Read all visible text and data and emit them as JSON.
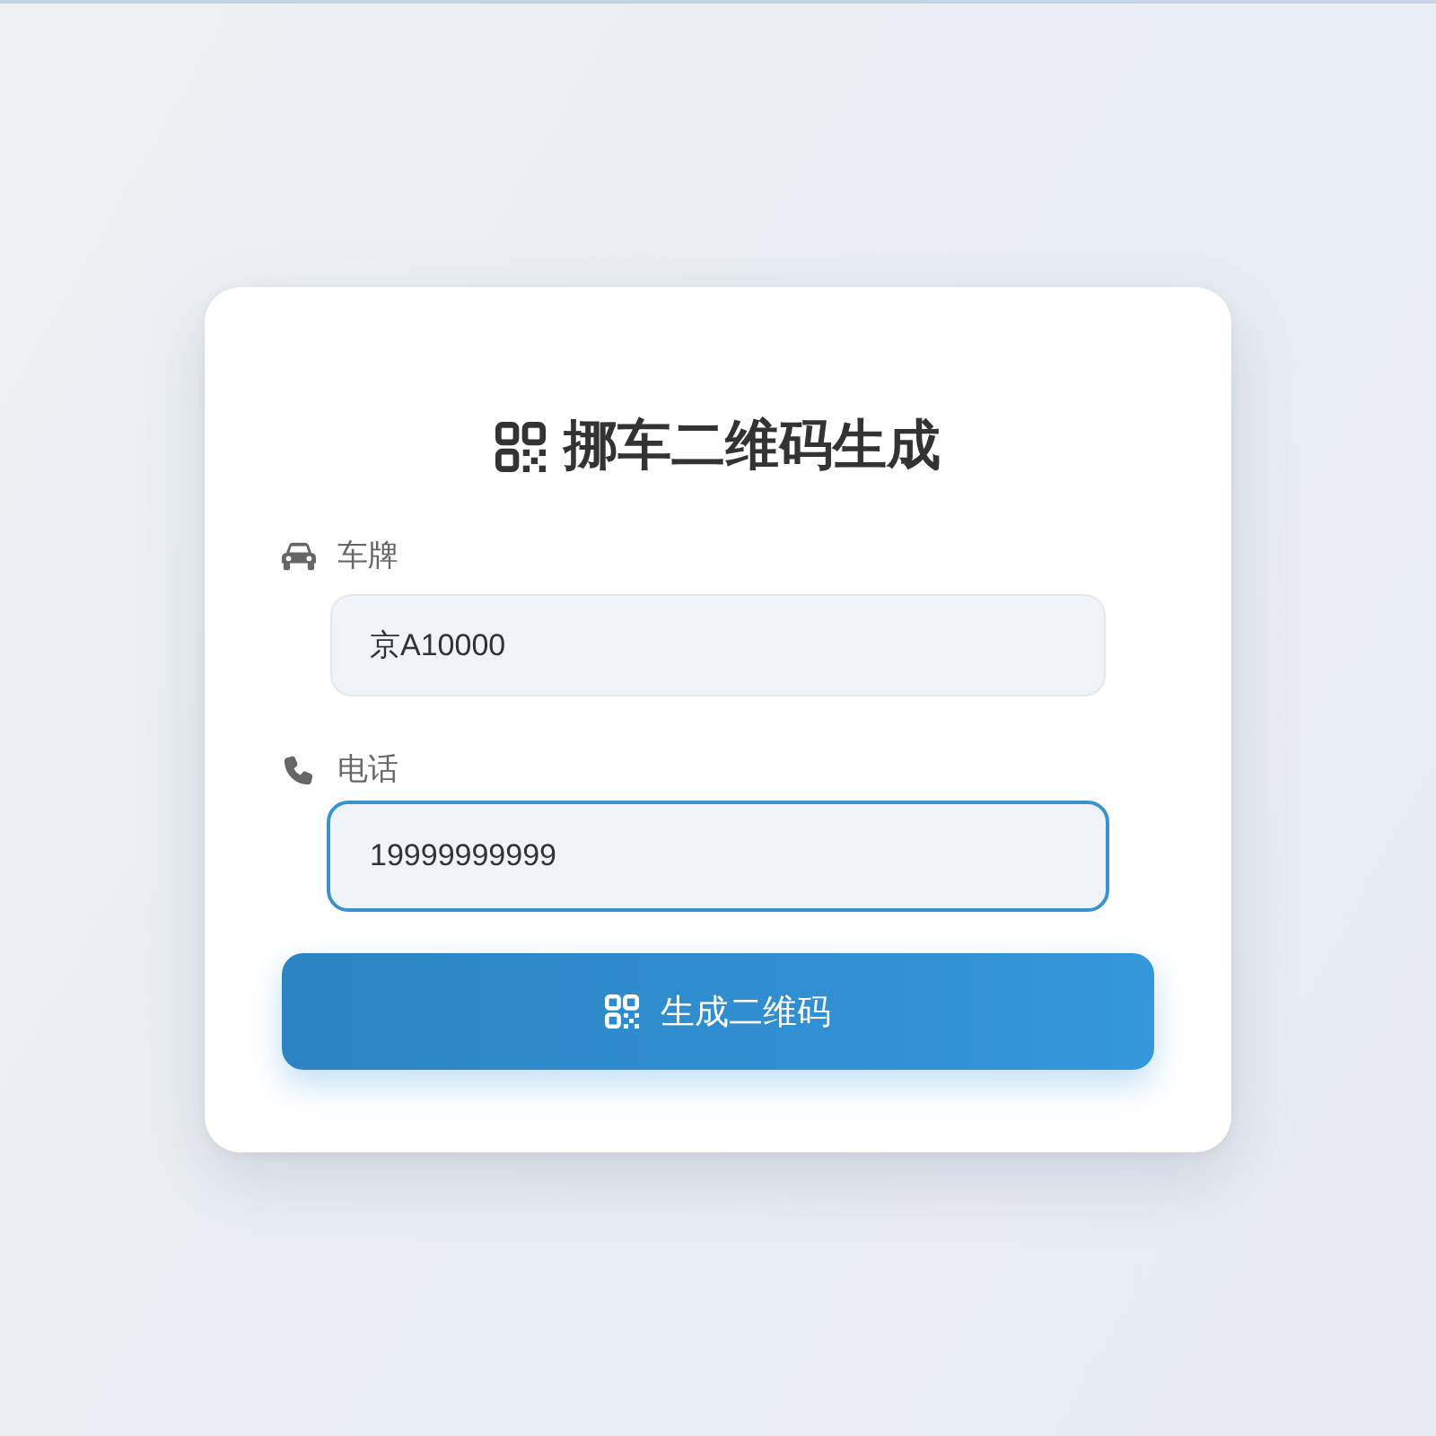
{
  "title": {
    "text": "挪车二维码生成"
  },
  "fields": [
    {
      "kind": "car",
      "label": "车牌",
      "value": "京A10000",
      "focused": false
    },
    {
      "kind": "phone",
      "label": "电话",
      "value": "19999999999",
      "focused": true
    }
  ],
  "button": {
    "label": "生成二维码"
  }
}
